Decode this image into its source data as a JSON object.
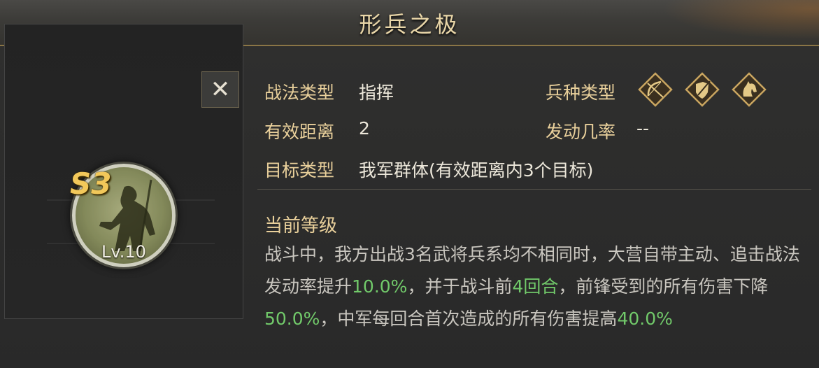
{
  "title": "形兵之极",
  "close_label": "✕",
  "skill": {
    "grade": "S3",
    "level": "Lv.10"
  },
  "info": {
    "tactic_type_label": "战法类型",
    "tactic_type_value": "指挥",
    "range_label": "有效距离",
    "range_value": "2",
    "target_label": "目标类型",
    "target_value": "我军群体(有效距离内3个目标)",
    "troop_type_label": "兵种类型",
    "troop_types": [
      "bow-icon",
      "shield-icon",
      "horse-icon"
    ],
    "trigger_rate_label": "发动几率",
    "trigger_rate_value": "--"
  },
  "current_level": {
    "title": "当前等级",
    "description": [
      {
        "text": "战斗中，我方出战3名武将兵系均不相同时，大营自带主动、追击战法发动率提升",
        "highlight": false
      },
      {
        "text": "10.0%",
        "highlight": true
      },
      {
        "text": "，并于战斗前",
        "highlight": false
      },
      {
        "text": "4回合",
        "highlight": true
      },
      {
        "text": "，前锋受到的所有伤害下降",
        "highlight": false
      },
      {
        "text": "50.0%",
        "highlight": true
      },
      {
        "text": "，中军每回合首次造成的所有伤害提高",
        "highlight": false
      },
      {
        "text": "40.0%",
        "highlight": true
      }
    ]
  },
  "colors": {
    "label": "#e9d09b",
    "highlight": "#71c96a",
    "grade": "#f2c85a"
  }
}
